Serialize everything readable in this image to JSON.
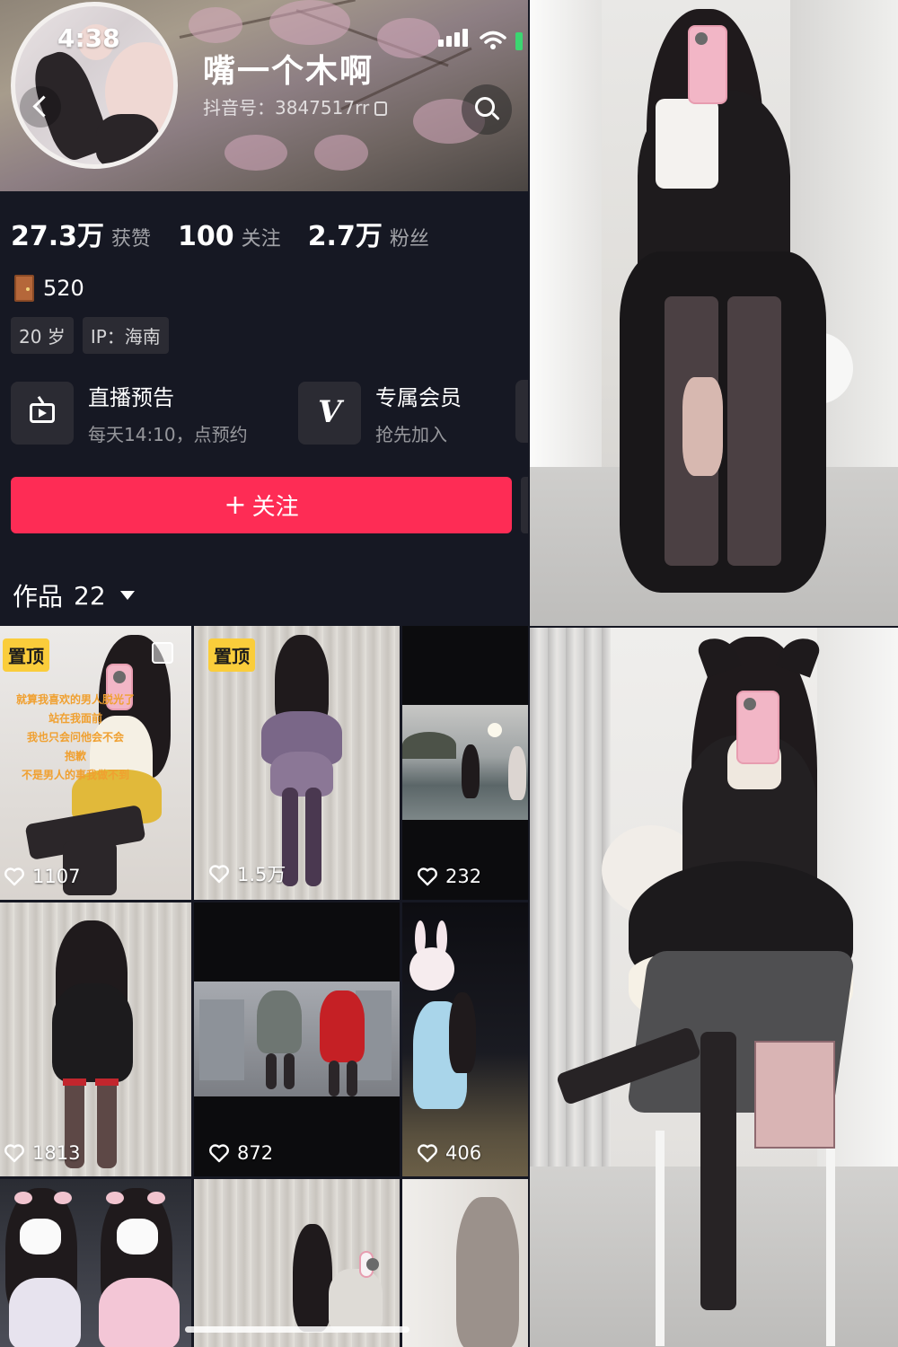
{
  "status_bar": {
    "time": "4:38"
  },
  "profile": {
    "name": "嘴一个木啊",
    "douyin_id": "抖音号：3847517rr",
    "stats": [
      {
        "value": "27.3万",
        "label": "获赞"
      },
      {
        "value": "100",
        "label": "关注"
      },
      {
        "value": "2.7万",
        "label": "粉丝"
      }
    ],
    "door_number": "520",
    "tags": [
      "20 岁",
      "IP：海南"
    ]
  },
  "features": [
    {
      "title": "直播预告",
      "subtitle": "每天14:10，点预约",
      "icon": "tv-icon"
    },
    {
      "title": "专属会员",
      "subtitle": "抢先加入",
      "icon": "v-icon"
    }
  ],
  "follow_button": {
    "label": "关注"
  },
  "works": {
    "label": "作品",
    "count": "22",
    "items": [
      {
        "pinned": true,
        "pin_label": "置顶",
        "likes": "1107",
        "overlay": [
          "就算我喜欢的男人脱光了",
          "站在我面前",
          "我也只会问他会不会",
          "抱歉",
          "不是男人的事我做不到"
        ]
      },
      {
        "pinned": true,
        "pin_label": "置顶",
        "likes": "1.5万"
      },
      {
        "pinned": false,
        "likes": "232"
      },
      {
        "pinned": false,
        "likes": "1813"
      },
      {
        "pinned": false,
        "likes": "872"
      },
      {
        "pinned": false,
        "likes": "406"
      },
      {
        "pinned": false,
        "likes": ""
      },
      {
        "pinned": false,
        "likes": ""
      },
      {
        "pinned": false,
        "likes": ""
      }
    ]
  },
  "colors": {
    "background": "#161823",
    "follow": "#fe2c55",
    "pin_badge": "#facd3b",
    "card": "#2b2b33"
  }
}
